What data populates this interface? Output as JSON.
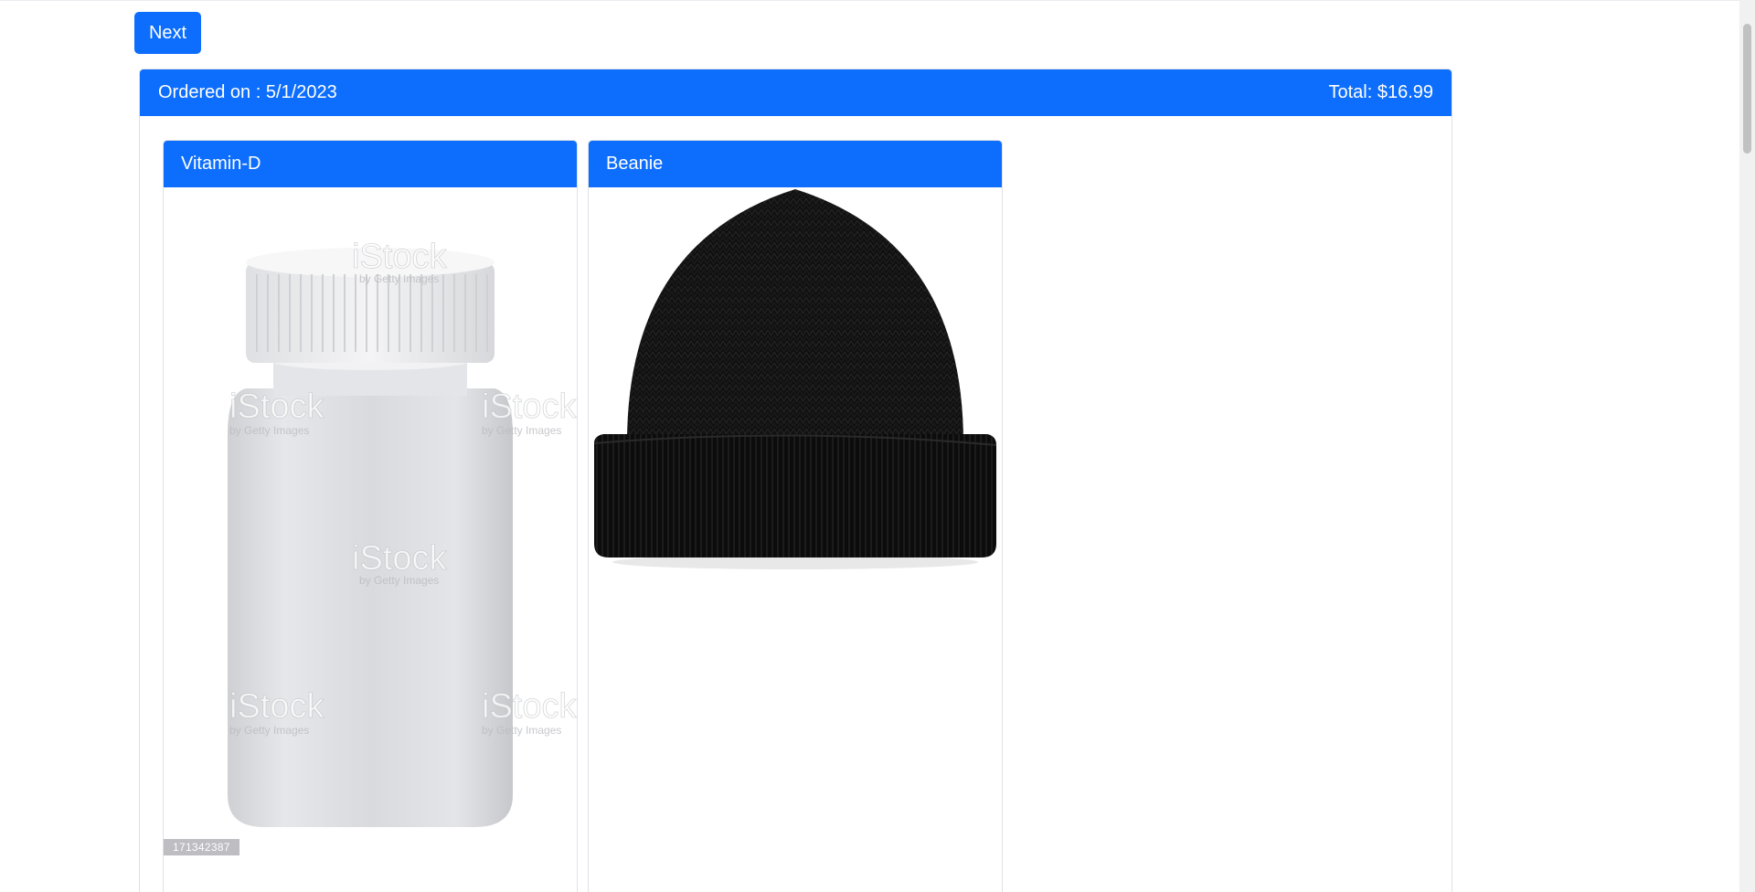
{
  "nav": {
    "next_label": "Next"
  },
  "order": {
    "ordered_on": "Ordered on : 5/1/2023",
    "total": "Total: $16.99",
    "items": [
      {
        "name": "Vitamin-D",
        "image": "white-supplement-bottle",
        "stock_id": "171342387"
      },
      {
        "name": "Beanie",
        "image": "black-knit-beanie"
      }
    ]
  },
  "watermark": {
    "brand": "iStock",
    "credit": "by Getty Images"
  },
  "colors": {
    "primary": "#0d6efd",
    "border": "#dee2e6",
    "background": "#ffffff"
  }
}
